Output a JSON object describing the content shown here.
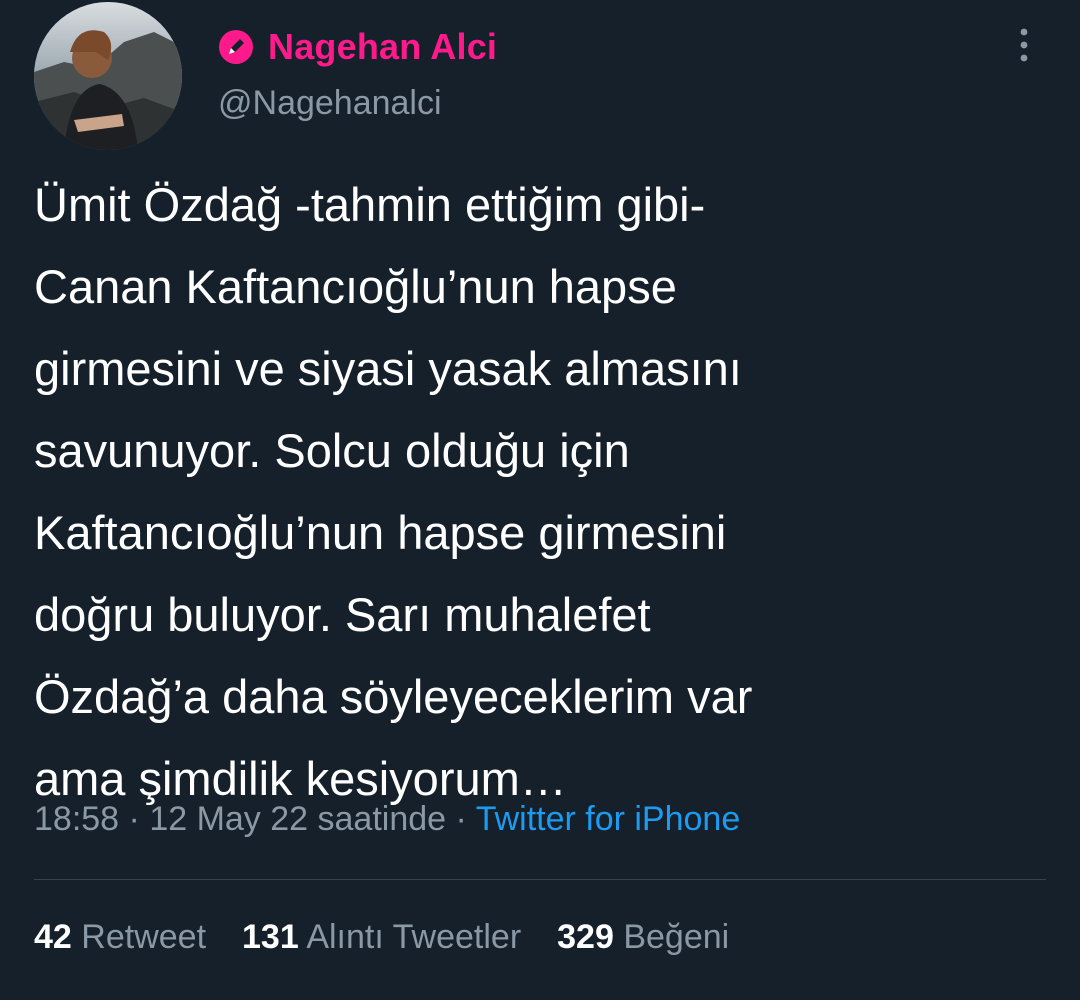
{
  "colors": {
    "background": "#15202b",
    "name": "#ff1a8c",
    "secondary_text": "#8b98a5",
    "link": "#1d9bf0",
    "divider": "#38444d"
  },
  "author": {
    "name": "Nagehan Alci",
    "handle": "@Nagehanalci",
    "name_icon": "pen-badge-icon",
    "avatar": "profile-photo"
  },
  "tweet": {
    "text": "Ümit Özdağ -tahmin ettiğim gibi-\nCanan Kaftancıoğlu’nun hapse\ngirmesini ve siyasi yasak almasını\nsavunuyor. Solcu olduğu için\nKaftancıoğlu’nun hapse girmesini\ndoğru buluyor. Sarı muhalefet\nÖzdağ’a daha söyleyeceklerim var\nama şimdilik kesiyorum…",
    "time": "18:58",
    "separator": " · ",
    "date": "12 May 22 saatinde",
    "source": "Twitter for iPhone"
  },
  "stats": {
    "retweets_count": "42",
    "retweets_label": "Retweet",
    "quotes_count": "131",
    "quotes_label": "Alıntı Tweetler",
    "likes_count": "329",
    "likes_label": "Beğeni"
  }
}
